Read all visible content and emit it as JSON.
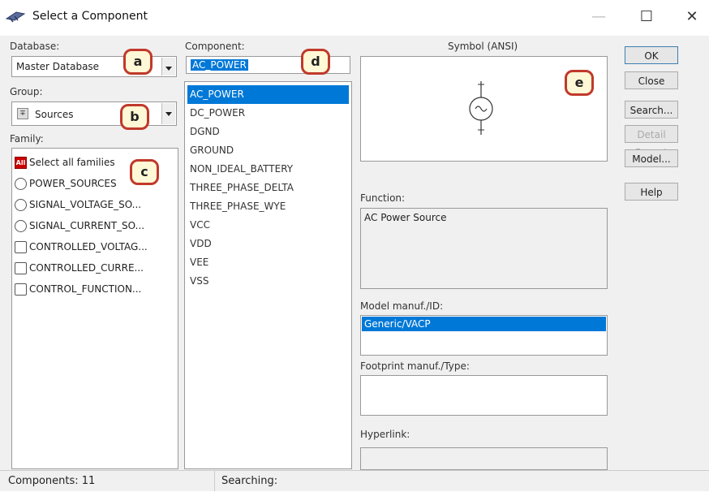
{
  "window": {
    "title": "Select a Component",
    "controls": {
      "minimize": "—",
      "maximize": "☐",
      "close": "✕"
    }
  },
  "database": {
    "label": "Database:",
    "value": "Master Database"
  },
  "group": {
    "label": "Group:",
    "value": "Sources"
  },
  "family": {
    "label": "Family:",
    "items": [
      {
        "label": "Select all families",
        "icon": "all-icon"
      },
      {
        "label": "POWER_SOURCES",
        "icon": "power-source-icon"
      },
      {
        "label": "SIGNAL_VOLTAGE_SO...",
        "icon": "signal-voltage-icon"
      },
      {
        "label": "SIGNAL_CURRENT_SO...",
        "icon": "signal-current-icon"
      },
      {
        "label": "CONTROLLED_VOLTAG...",
        "icon": "controlled-voltage-icon"
      },
      {
        "label": "CONTROLLED_CURRE...",
        "icon": "controlled-current-icon"
      },
      {
        "label": "CONTROL_FUNCTION...",
        "icon": "control-function-icon"
      }
    ]
  },
  "component": {
    "label": "Component:",
    "search_value": "AC_POWER",
    "items": [
      "AC_POWER",
      "DC_POWER",
      "DGND",
      "GROUND",
      "NON_IDEAL_BATTERY",
      "THREE_PHASE_DELTA",
      "THREE_PHASE_WYE",
      "VCC",
      "VDD",
      "VEE",
      "VSS"
    ],
    "selected_index": 0
  },
  "symbol": {
    "label": "Symbol (ANSI)"
  },
  "function": {
    "label": "Function:",
    "value": "AC Power Source"
  },
  "model": {
    "label": "Model manuf./ID:",
    "value": "Generic/VACP"
  },
  "footprint": {
    "label": "Footprint manuf./Type:"
  },
  "hyperlink": {
    "label": "Hyperlink:"
  },
  "buttons": {
    "ok": "OK",
    "close": "Close",
    "search": "Search...",
    "detail_report": "Detail Report",
    "model": "Model...",
    "help": "Help"
  },
  "callouts": [
    "a",
    "b",
    "c",
    "d",
    "e"
  ],
  "status": {
    "components": "Components: 11",
    "searching": "Searching:"
  },
  "colors": {
    "selection": "#0078d7",
    "callout_border": "#c0392b",
    "callout_fill": "#fff8d6"
  }
}
